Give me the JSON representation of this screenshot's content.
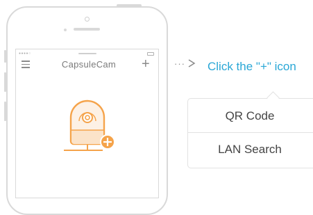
{
  "device": {
    "app_title": "CapsuleCam",
    "status_dots": "●●●●○",
    "menu_icon": "hamburger-menu-icon",
    "add_icon_glyph": "+",
    "illustration": "capsule-camera-add-icon"
  },
  "instruction": {
    "arrow": "···",
    "text": "Click the \"+\" icon"
  },
  "popup": {
    "items": [
      {
        "label": "QR Code"
      },
      {
        "label": "LAN Search"
      }
    ]
  },
  "colors": {
    "accent_blue": "#2aa7d6",
    "orange": "#f5a34a",
    "phone_gray": "#d9d9d9",
    "text_gray": "#7a7a7a"
  }
}
